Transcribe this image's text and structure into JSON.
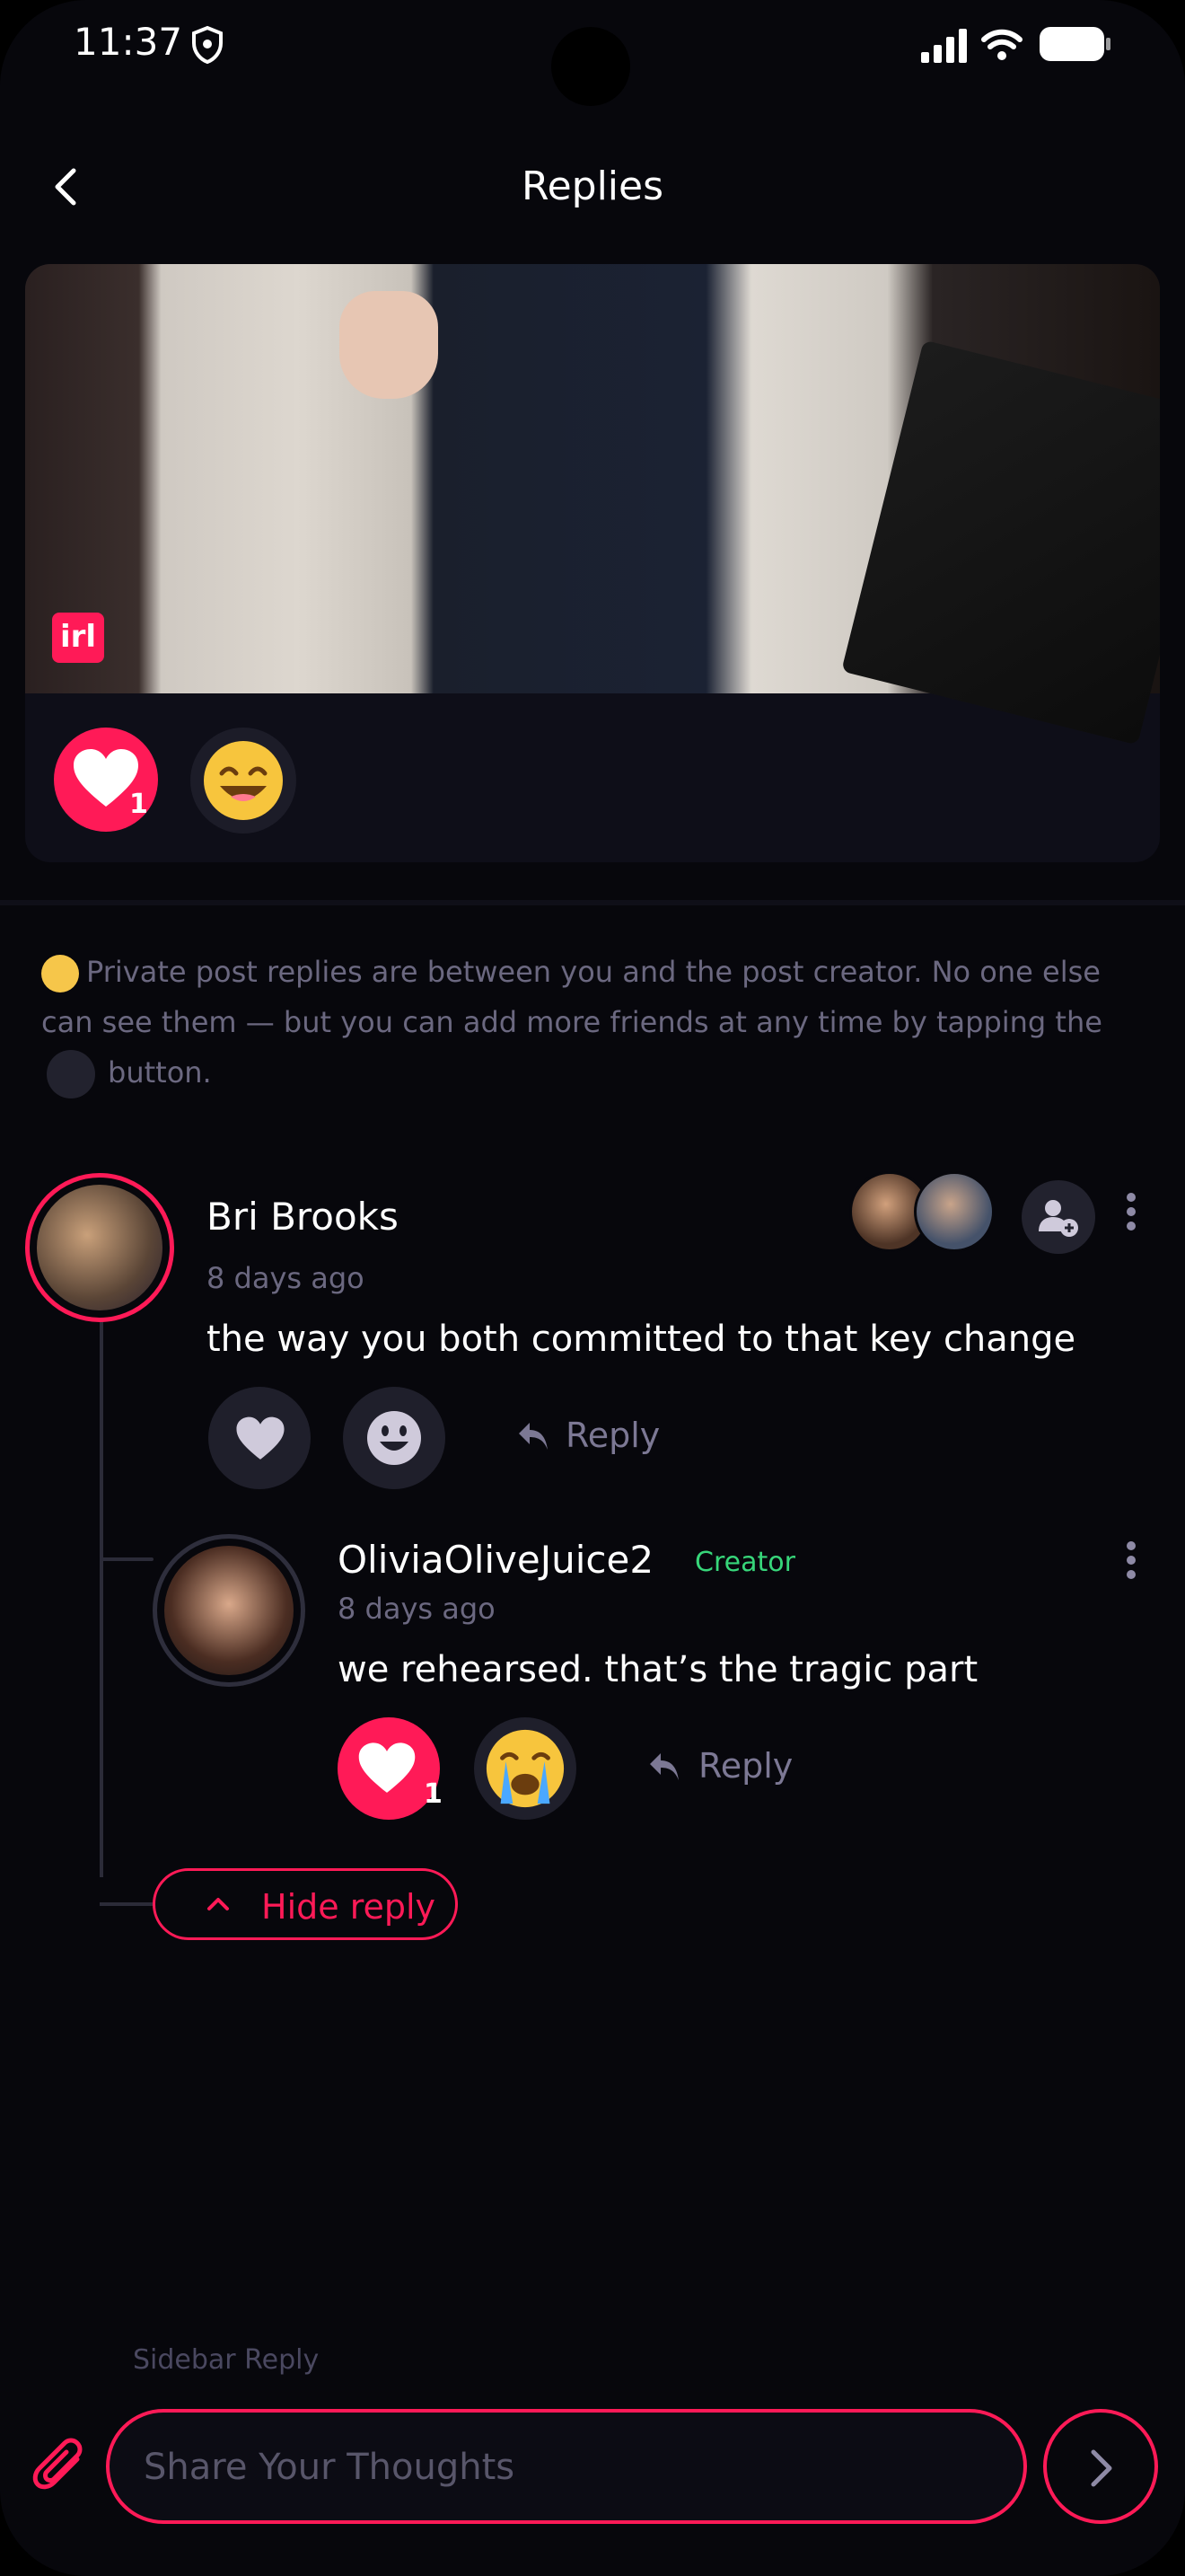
{
  "status_bar": {
    "time": "11:37",
    "icons": [
      "shield-icon",
      "signal-icon",
      "wifi-icon",
      "battery-icon"
    ]
  },
  "header": {
    "title": "Replies",
    "back_icon": "chevron-left-icon"
  },
  "post": {
    "badge": "irl",
    "reactions": [
      {
        "icon": "heart-icon",
        "count": "1"
      },
      {
        "icon": "grinning-emoji-icon"
      }
    ]
  },
  "info": {
    "text_1": "Private post replies are between you and the post creator. No one else can see them — but you can add more friends at any time by tapping the",
    "text_2": "button."
  },
  "comment": {
    "author": "Bri Brooks",
    "time": "8 days ago",
    "text": "the way you both committed to that key change",
    "reply_label": "Reply"
  },
  "reply": {
    "author": "OliviaOliveJuice2",
    "badge": "Creator",
    "time": "8 days ago",
    "text": "we rehearsed. that’s the tragic part",
    "heart_count": "1",
    "reply_label": "Reply"
  },
  "hide_reply_label": "Hide reply",
  "composer": {
    "sidebar_label": "Sidebar Reply",
    "placeholder": "Share Your Thoughts"
  },
  "colors": {
    "accent": "#ff1a57",
    "creator": "#37d67a",
    "muted": "#6b6880",
    "background": "#07070c"
  }
}
